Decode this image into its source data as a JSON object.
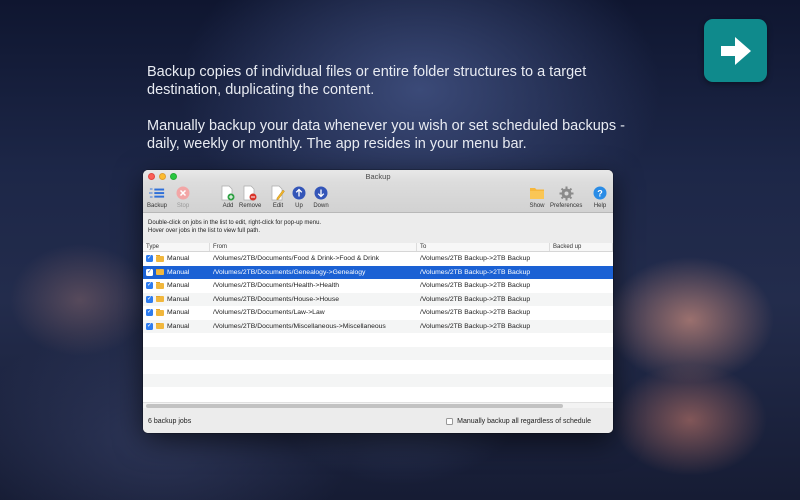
{
  "hero": {
    "paragraph1": "Backup copies of individual files or entire folder structures to a target destination, duplicating the content.",
    "paragraph2": "Manually backup your data whenever you wish or set scheduled backups - daily, weekly or monthly. The app resides in your menu bar."
  },
  "app_icon": {
    "icon": "arrow-right-icon",
    "color": "#0f8a8c"
  },
  "window": {
    "title": "Backup",
    "toolbar": {
      "backup": "Backup",
      "stop": "Stop",
      "add": "Add",
      "remove": "Remove",
      "edit": "Edit",
      "up": "Up",
      "down": "Down",
      "show": "Show",
      "preferences": "Preferences",
      "help": "Help"
    },
    "hint_line1": "Double-click on jobs in the list to edit, right-click for pop-up menu.",
    "hint_line2": "Hover over jobs in the list to view full path.",
    "columns": {
      "type": "Type",
      "from": "From",
      "to": "To",
      "backed_up": "Backed up"
    },
    "rows": [
      {
        "checked": "✓",
        "type": "Manual",
        "from": "/Volumes/2TB/Documents/Food & Drink->Food & Drink",
        "to": "/Volumes/2TB Backup->2TB Backup",
        "backed_up": ""
      },
      {
        "checked": "✓",
        "type": "Manual",
        "from": "/Volumes/2TB/Documents/Genealogy->Genealogy",
        "to": "/Volumes/2TB Backup->2TB Backup",
        "backed_up": ""
      },
      {
        "checked": "✓",
        "type": "Manual",
        "from": "/Volumes/2TB/Documents/Health->Health",
        "to": "/Volumes/2TB Backup->2TB Backup",
        "backed_up": ""
      },
      {
        "checked": "✓",
        "type": "Manual",
        "from": "/Volumes/2TB/Documents/House->House",
        "to": "/Volumes/2TB Backup->2TB Backup",
        "backed_up": ""
      },
      {
        "checked": "✓",
        "type": "Manual",
        "from": "/Volumes/2TB/Documents/Law->Law",
        "to": "/Volumes/2TB Backup->2TB Backup",
        "backed_up": ""
      },
      {
        "checked": "✓",
        "type": "Manual",
        "from": "/Volumes/2TB/Documents/Miscellaneous->Miscellaneous",
        "to": "/Volumes/2TB Backup->2TB Backup",
        "backed_up": ""
      }
    ],
    "selected_row": 1,
    "status_text": "6 backup jobs",
    "manual_all_label": "Manually backup all regardless of schedule",
    "colors": {
      "selection": "#1b61d4",
      "accent": "#2d7cf0"
    }
  }
}
